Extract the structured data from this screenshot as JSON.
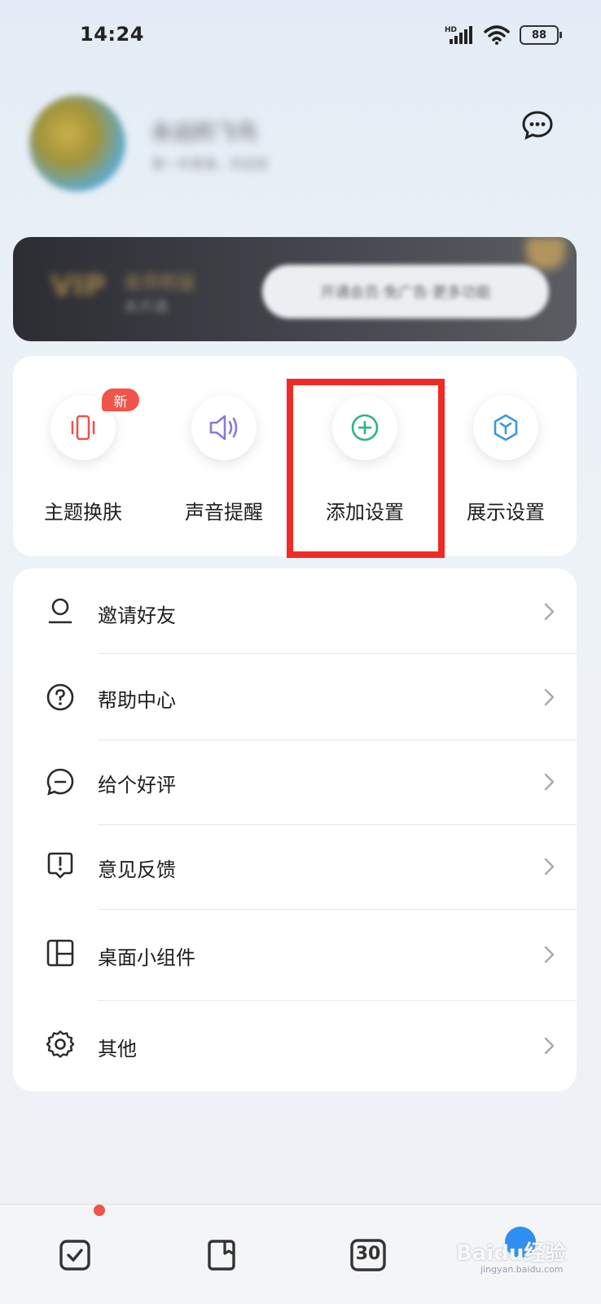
{
  "status_bar": {
    "time": "14:24",
    "network": "HD",
    "battery": "88"
  },
  "profile": {
    "username": "永远的飞鸟",
    "subtitle": "第一天登录，欢迎您"
  },
  "vip": {
    "logo": "VIP",
    "title": "会员权益",
    "status": "未开通",
    "cta": "开通会员·免广告·更多功能"
  },
  "quick_actions": [
    {
      "label": "主题换肤",
      "icon": "phone-vibrate-icon",
      "badge": "新",
      "color": "#e8554e"
    },
    {
      "label": "声音提醒",
      "icon": "speaker-icon",
      "color": "#8a78d8"
    },
    {
      "label": "添加设置",
      "icon": "add-circle-icon",
      "color": "#2db38a"
    },
    {
      "label": "展示设置",
      "icon": "cube-icon",
      "color": "#3b97e0"
    }
  ],
  "menu": [
    {
      "label": "邀请好友",
      "icon": "person-icon"
    },
    {
      "label": "帮助中心",
      "icon": "question-circle-icon"
    },
    {
      "label": "给个好评",
      "icon": "comment-icon"
    },
    {
      "label": "意见反馈",
      "icon": "feedback-icon"
    },
    {
      "label": "桌面小组件",
      "icon": "widget-icon"
    },
    {
      "label": "其他",
      "icon": "gear-icon"
    }
  ],
  "bottom_nav": [
    {
      "icon": "checkbox-icon"
    },
    {
      "icon": "notebook-icon"
    },
    {
      "icon": "calendar-icon",
      "label": "30"
    },
    {
      "icon": "me-icon"
    }
  ],
  "watermark": {
    "brand": "Baidu经验",
    "url": "jingyan.baidu.com"
  },
  "colors": {
    "highlight": "#f02a24",
    "badge": "#f2534a"
  }
}
